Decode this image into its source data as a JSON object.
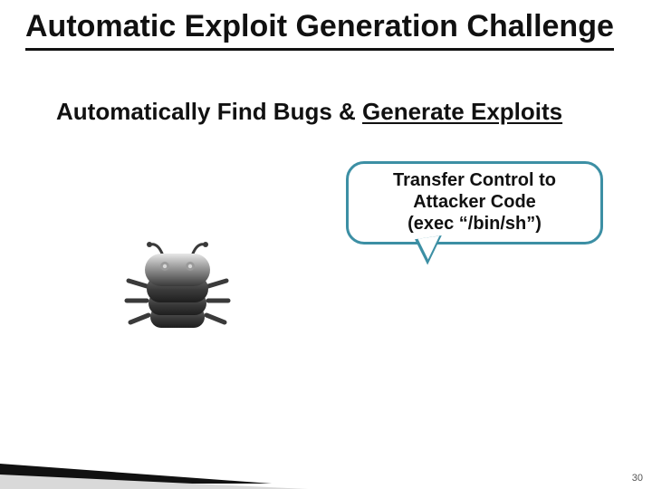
{
  "title": "Automatic Exploit Generation Challenge",
  "subtitle_plain_prefix": "Automatically Find Bugs & ",
  "subtitle_underlined": "Generate Exploits",
  "callout": {
    "line1": "Transfer Control to",
    "line2": "Attacker Code",
    "line3": "(exec “/bin/sh”)"
  },
  "page_number": "30",
  "icons": {
    "bug": "bug-icon"
  }
}
